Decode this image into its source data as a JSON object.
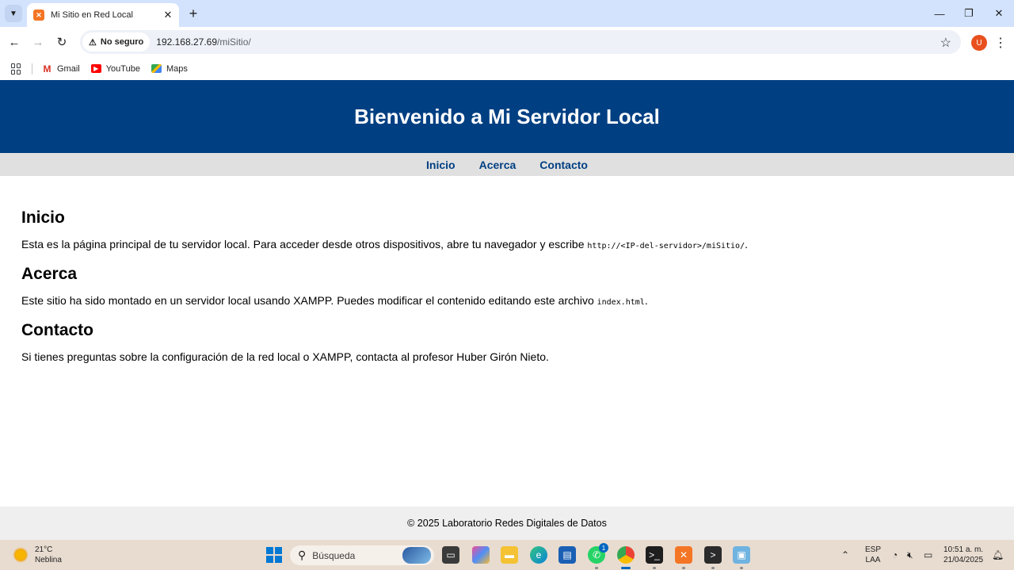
{
  "browser": {
    "tab": {
      "title": "Mi Sitio en Red Local"
    },
    "omnibox": {
      "security_label": "No seguro",
      "url_host": "192.168.27.69",
      "url_path": "/miSitio/"
    },
    "profile_initial": "U",
    "bookmarks": [
      {
        "label": "Gmail",
        "icon": "gmail-icon"
      },
      {
        "label": "YouTube",
        "icon": "youtube-icon"
      },
      {
        "label": "Maps",
        "icon": "maps-icon"
      }
    ]
  },
  "page": {
    "header_title": "Bienvenido a Mi Servidor Local",
    "nav": [
      "Inicio",
      "Acerca",
      "Contacto"
    ],
    "sections": [
      {
        "heading": "Inicio",
        "text_before": "Esta es la página principal de tu servidor local. Para acceder desde otros dispositivos, abre tu navegador y escribe ",
        "code": "http://<IP-del-servidor>/miSitio/",
        "text_after": "."
      },
      {
        "heading": "Acerca",
        "text_before": "Este sitio ha sido montado en un servidor local usando XAMPP. Puedes modificar el contenido editando este archivo ",
        "code": "index.html",
        "text_after": "."
      },
      {
        "heading": "Contacto",
        "text_before": "Si tienes preguntas sobre la configuración de la red local o XAMPP, contacta al profesor Huber Girón Nieto.",
        "code": "",
        "text_after": ""
      }
    ],
    "footer": "© 2025 Laboratorio Redes Digitales de Datos"
  },
  "taskbar": {
    "weather_temp": "21°C",
    "weather_desc": "Neblina",
    "search_placeholder": "Búsqueda",
    "whatsapp_badge": "1",
    "lang_line1": "ESP",
    "lang_line2": "LAA",
    "time": "10:51 a. m.",
    "date": "21/04/2025"
  },
  "colors": {
    "header_bg": "#003f82",
    "nav_bg": "#e0e0e0",
    "nav_link": "#003f82",
    "footer_bg": "#efefef",
    "tabbar_bg": "#d3e3fd",
    "taskbar_bg": "#e8dcd0"
  }
}
